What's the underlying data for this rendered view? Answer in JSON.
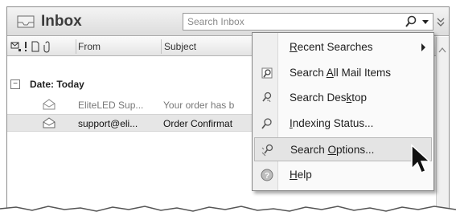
{
  "window": {
    "title": "Inbox",
    "search": {
      "placeholder": "Search Inbox"
    }
  },
  "columns": {
    "from": "From",
    "subject": "Subject"
  },
  "group": {
    "label": "Date: Today",
    "toggle": "−"
  },
  "messages": [
    {
      "from": "EliteLED Sup...",
      "subject": "Your order has b",
      "state": "read"
    },
    {
      "from": "support@eli...",
      "subject": "Order Confirmat",
      "state": "selected"
    }
  ],
  "menu": {
    "items": [
      {
        "label_pre": "",
        "label_u": "R",
        "label_post": "ecent Searches",
        "icon": "none",
        "submenu": true
      },
      {
        "label_pre": "Search ",
        "label_u": "A",
        "label_post": "ll Mail Items",
        "icon": "search-mail-icon"
      },
      {
        "label_pre": "Search Des",
        "label_u": "k",
        "label_post": "top",
        "icon": "search-desktop-icon"
      },
      {
        "label_pre": "",
        "label_u": "I",
        "label_post": "ndexing Status...",
        "icon": "indexing-icon"
      },
      {
        "label_pre": "Search ",
        "label_u": "O",
        "label_post": "ptions...",
        "icon": "search-options-icon",
        "highlighted": true
      },
      {
        "label_pre": "",
        "label_u": "H",
        "label_post": "elp",
        "icon": "help-icon"
      }
    ]
  },
  "colors": {
    "titlebar": "#dcdcdc",
    "menu_bg": "#fafafa",
    "highlight": "#e4e4e4"
  }
}
